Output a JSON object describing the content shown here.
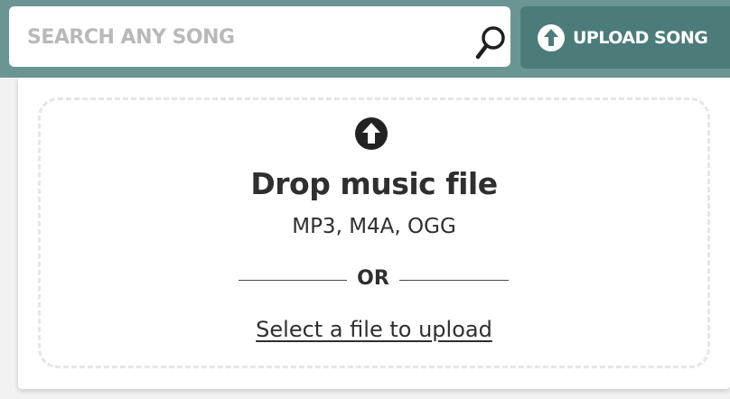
{
  "search": {
    "placeholder": "SEARCH ANY SONG",
    "icon": "search-icon"
  },
  "header": {
    "upload_button_label": "UPLOAD SONG",
    "upload_icon": "upload-arrow-icon"
  },
  "dropzone": {
    "icon": "upload-arrow-icon",
    "title": "Drop music file",
    "formats": "MP3, M4A, OGG",
    "divider_text": "OR",
    "select_link": "Select a file to upload"
  },
  "colors": {
    "header_bg": "#6b9593",
    "button_bg": "#4c7c79",
    "text": "#2f2f2f",
    "placeholder": "#b9b9b9"
  }
}
